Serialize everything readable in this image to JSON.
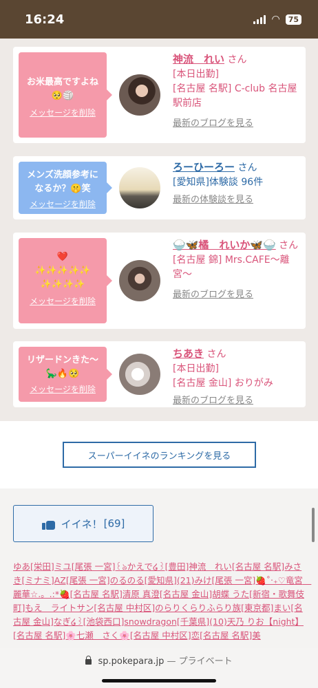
{
  "status_bar": {
    "time": "16:24",
    "battery": "75"
  },
  "cards": [
    {
      "message": "お米最高ですよね🥺🏐",
      "delete": "メッセージを削除",
      "name": "神流　れい",
      "san": "さん",
      "detail": "[本日出勤]\n[名古屋 名駅] C-club 名古屋駅前店",
      "link": "最新のブログを見る"
    },
    {
      "message": "メンズ洗顔参考になるか？🤫笑",
      "delete": "メッセージを削除",
      "name": "ろーひーろー",
      "san": "さん",
      "detail": "[愛知県]体験談 96件",
      "link": "最新の体験談を見る"
    },
    {
      "message": "❤️\n✨✨✨✨✨\n✨✨✨✨",
      "delete": "メッセージを削除",
      "name": "🍚🦋橘　れいか🦋🍚",
      "san": "さん",
      "detail": "[名古屋 錦] Mrs.CAFE〜離宮〜",
      "link": "最新のブログを見る"
    },
    {
      "message": "リザードンきた〜🦕🔥🥺",
      "delete": "メッセージを削除",
      "name": "ちあき",
      "san": "さん",
      "detail": "[本日出勤]\n[名古屋 金山] おりがみ",
      "link": "最新のブログを見る"
    }
  ],
  "ranking_button": "スーパーイイネのランキングを見る",
  "like_button": {
    "label": "イイネ！",
    "count": "[69]"
  },
  "likers_text": "ゆあ[栄田]ミユ[尾張 一宮]꒰ঌかえで໒꒱[豊田]神流　れい[名古屋 名駅]みさき[ミナミ]AZ[尾張 一宮]のるのる[愛知県](21)みけ[尾張 一宮]🍓˚‧₊♡竜宮　麗華☆.。.:*🍓[名古屋 名駅]清原 真澄[名古屋 金山]胡蝶 うた[新宿・歌舞伎町]もえ　ライトサン[名古屋 中村区]のらりくらりふらり族[東京都]まい[名古屋 金山]なぎ໒꒱[池袋西口]snowdragon[千葉県](10)天乃 りお【night】[名古屋 名駅]🌸七瀬　さく🌸[名古屋 中村区]恋[名古屋 名駅]美",
  "url_bar": {
    "domain": "sp.pokepara.jp",
    "suffix": "— プライベート"
  }
}
